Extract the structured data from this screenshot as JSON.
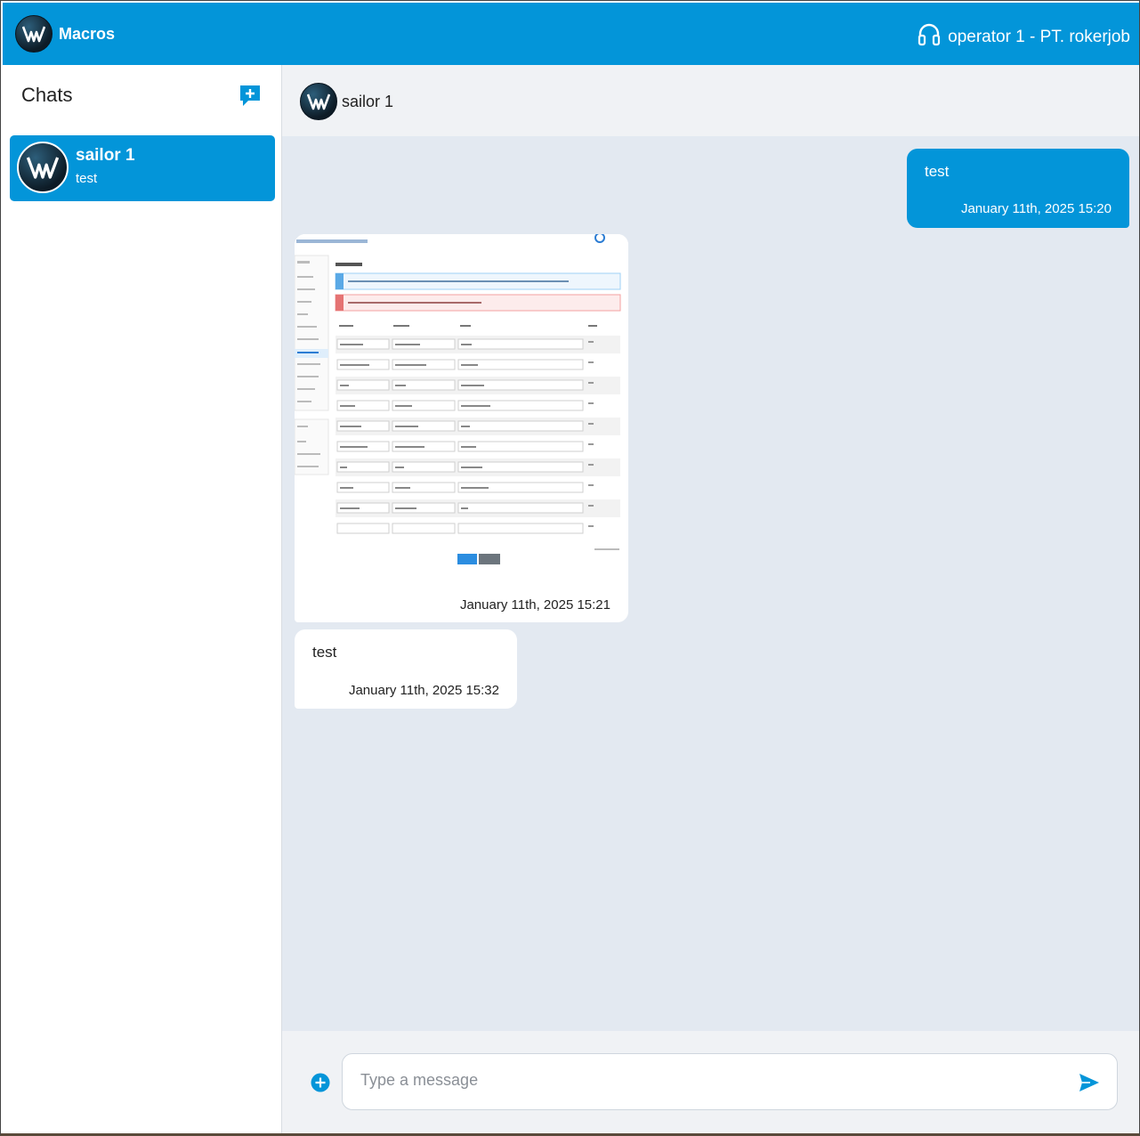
{
  "app": {
    "name": "Macros"
  },
  "header": {
    "operator_label": "operator 1 - PT. rokerjob",
    "headset_icon": "headset-icon"
  },
  "sidebar": {
    "title": "Chats",
    "new_chat_icon": "new-chat-icon",
    "chats": [
      {
        "name": "sailor 1",
        "preview": "test"
      }
    ]
  },
  "conversation": {
    "contact_name": "sailor 1",
    "messages": [
      {
        "direction": "out",
        "type": "text",
        "text": "test",
        "time": "January 11th, 2025 15:20"
      },
      {
        "direction": "in",
        "type": "image",
        "time": "January 11th, 2025 15:21"
      },
      {
        "direction": "in",
        "type": "text",
        "text": "test",
        "time": "January 11th, 2025 15:32"
      }
    ]
  },
  "composer": {
    "placeholder": "Type a message"
  },
  "colors": {
    "accent": "#0395d9",
    "chat_bg": "#e3e9f1",
    "panel_bg": "#f0f2f5"
  }
}
